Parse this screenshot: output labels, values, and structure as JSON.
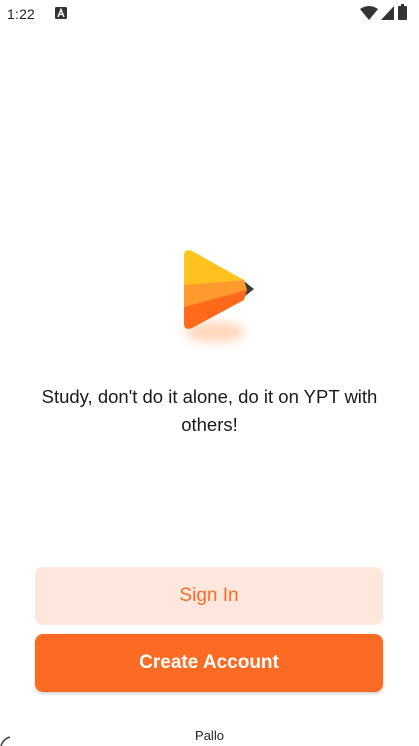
{
  "status_bar": {
    "time": "1:22",
    "icons": [
      "text-notification-icon",
      "wifi-icon",
      "cellular-signal-icon",
      "battery-icon"
    ]
  },
  "logo": {
    "icon": "play-logo-icon",
    "colors": {
      "light": "#ffc21e",
      "mid": "#ff9a2e",
      "dark": "#ff6a1a",
      "shade": "#3a3a3a"
    }
  },
  "tagline": "Study, don't do it alone, do it on YPT with others!",
  "buttons": {
    "sign_in": "Sign In",
    "create_account": "Create Account"
  },
  "footer": {
    "label": "Pallo"
  },
  "colors": {
    "accent": "#fb6b24",
    "accent_light": "#fee8de",
    "text": "#1a1a1a"
  }
}
